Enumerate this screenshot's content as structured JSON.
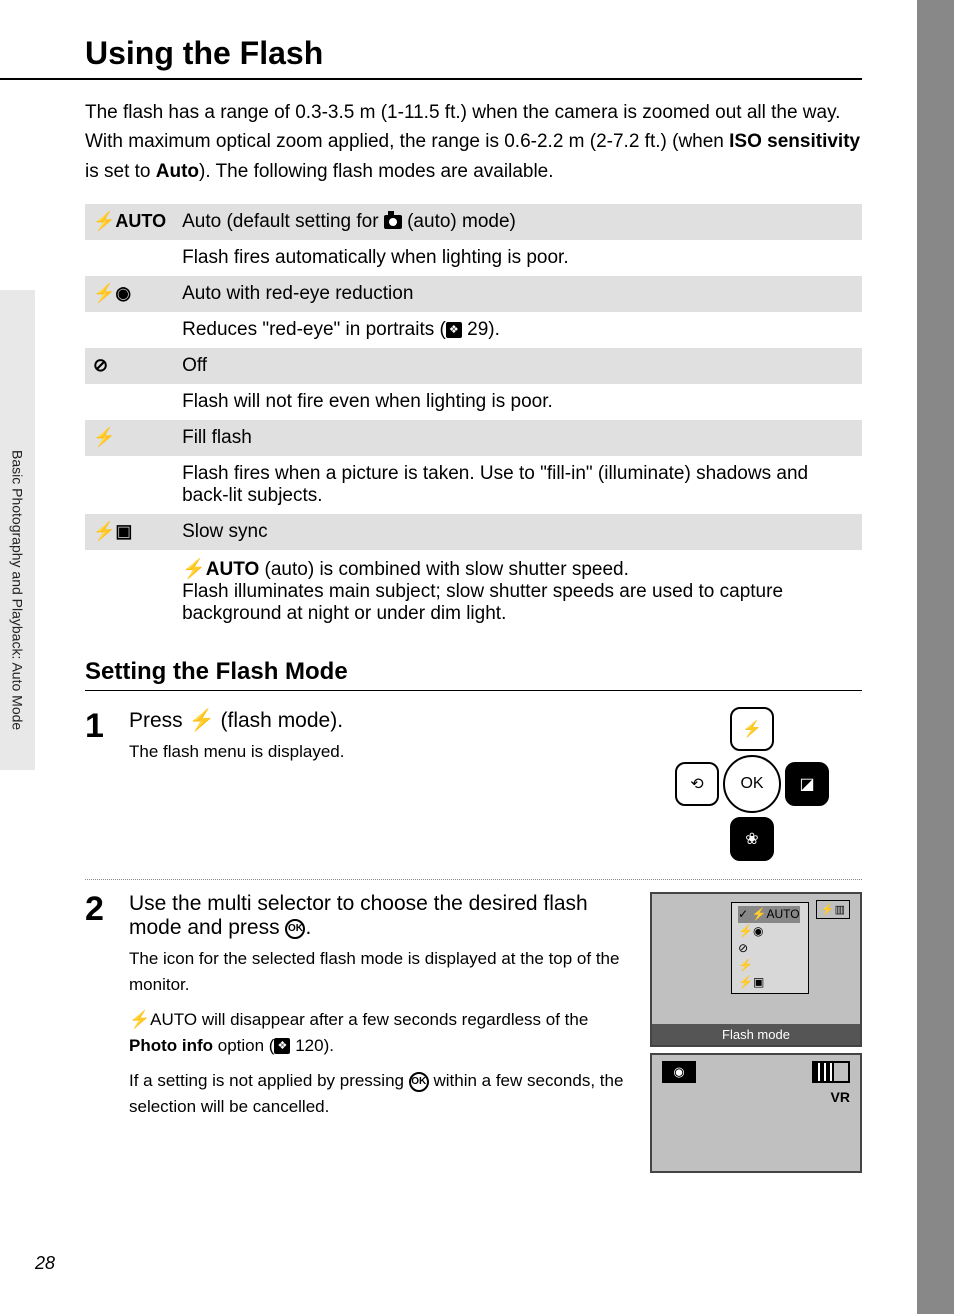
{
  "side_label": "Basic Photography and Playback: Auto Mode",
  "title": "Using the Flash",
  "intro_pre": "The flash has a range of 0.3-3.5 m (1-11.5 ft.) when the camera is zoomed out all the way. With maximum optical zoom applied, the range is 0.6-2.2 m (2-7.2 ft.) (when ",
  "intro_bold1": "ISO sensitivity",
  "intro_mid": " is set to ",
  "intro_bold2": "Auto",
  "intro_post": "). The following flash modes are available.",
  "modes": [
    {
      "icon": "⚡AUTO",
      "label_pre": "Auto (default setting for ",
      "label_post": " (auto) mode)",
      "desc": "Flash fires automatically when lighting is poor."
    },
    {
      "icon": "⚡◉",
      "label": "Auto with red-eye reduction",
      "desc_pre": "Reduces \"red-eye\" in portraits (",
      "desc_ref": "29",
      "desc_post": ")."
    },
    {
      "icon": "⊘",
      "label": "Off",
      "desc": "Flash will not fire even when lighting is poor."
    },
    {
      "icon": "⚡",
      "label": "Fill flash",
      "desc": "Flash fires when a picture is taken. Use to \"fill-in\" (illuminate) shadows and back-lit subjects."
    },
    {
      "icon": "⚡▣",
      "label": "Slow sync",
      "desc_icon": "⚡AUTO",
      "desc_pre": " (auto) is combined with slow shutter speed.",
      "desc_line2": "Flash illuminates main subject; slow shutter speeds are used to capture background at night or under dim light."
    }
  ],
  "subhead": "Setting the Flash Mode",
  "step1": {
    "num": "1",
    "title_pre": "Press ",
    "title_icon": "⚡",
    "title_post": " (flash mode).",
    "text": "The flash menu is displayed."
  },
  "step2": {
    "num": "2",
    "title_pre": "Use the multi selector to choose the desired flash mode and press ",
    "title_post": ".",
    "p1": "The icon for the selected flash mode is displayed at the top of the monitor.",
    "p2_icon": "⚡AUTO",
    "p2_pre": " will disappear after a few seconds regardless of the ",
    "p2_bold": "Photo info",
    "p2_mid": " option (",
    "p2_ref": "120",
    "p2_post": ").",
    "p3_pre": "If a setting is not applied by pressing ",
    "p3_post": " within a few seconds, the selection will be cancelled."
  },
  "dpad": {
    "up": "⚡",
    "down": "❀",
    "left": "⟲",
    "right": "◪",
    "ok": "OK"
  },
  "screen1": {
    "items": [
      "✓ ⚡AUTO",
      "⚡◉",
      "⊘",
      "⚡",
      "⚡▣"
    ],
    "side": "⚡▥",
    "footer": "Flash mode"
  },
  "screen2": {
    "cam": "◉",
    "batt_label": "⚡▥",
    "vr": "VR"
  },
  "page_number": "28"
}
